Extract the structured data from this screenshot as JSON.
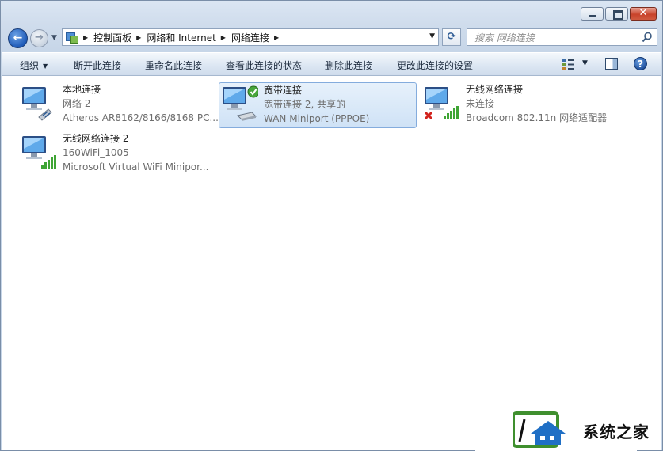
{
  "window": {
    "minimize_label": "▁",
    "maximize_label": "□",
    "close_label": "✕"
  },
  "nav": {
    "back_glyph": "←",
    "forward_glyph": "→",
    "breadcrumbs": [
      "控制面板",
      "网络和 Internet",
      "网络连接"
    ],
    "refresh_glyph": "⟳"
  },
  "search": {
    "placeholder": "搜索 网络连接"
  },
  "toolbar": {
    "organize_label": "组织",
    "disconnect_label": "断开此连接",
    "rename_label": "重命名此连接",
    "view_status_label": "查看此连接的状态",
    "delete_label": "删除此连接",
    "change_settings_label": "更改此连接的设置",
    "help_label": "?"
  },
  "connections": [
    {
      "name": "本地连接",
      "status": "网络  2",
      "device": "Atheros AR8162/8166/8168 PC...",
      "icon": "wired-network-icon",
      "selected": false
    },
    {
      "name": "宽带连接",
      "status": "宽带连接  2, 共享的",
      "device": "WAN Miniport (PPPOE)",
      "icon": "broadband-connected-icon",
      "selected": true
    },
    {
      "name": "无线网络连接",
      "status": "未连接",
      "device": "Broadcom 802.11n 网络适配器",
      "icon": "wireless-disconnected-icon",
      "selected": false
    },
    {
      "name": "无线网络连接 2",
      "status": "160WiFi_1005",
      "device": "Microsoft Virtual WiFi Minipor...",
      "icon": "wireless-network-icon",
      "selected": false
    }
  ],
  "colors": {
    "selection_fill": "#cfe2f6",
    "selection_border": "#84acdd",
    "close_button": "#c8432b",
    "secondary_text": "#6d6d6d"
  },
  "watermark": {
    "text": "系统之家"
  }
}
